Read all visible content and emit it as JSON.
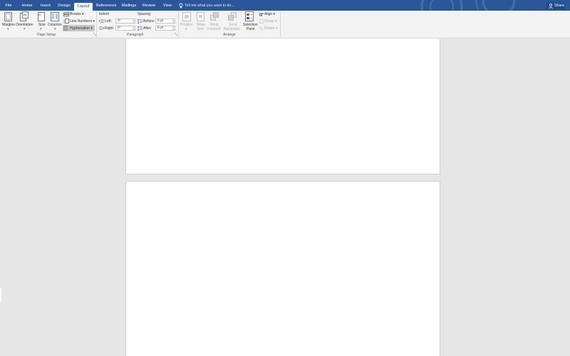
{
  "tabs": [
    {
      "label": "File",
      "active": false
    },
    {
      "label": "Home",
      "active": false
    },
    {
      "label": "Insert",
      "active": false
    },
    {
      "label": "Design",
      "active": false
    },
    {
      "label": "Layout",
      "active": true
    },
    {
      "label": "References",
      "active": false
    },
    {
      "label": "Mailings",
      "active": false
    },
    {
      "label": "Review",
      "active": false
    },
    {
      "label": "View",
      "active": false
    }
  ],
  "tell_me": {
    "placeholder": "Tell me what you want to do..."
  },
  "share": {
    "label": "Share"
  },
  "page_setup": {
    "margins": "Margins",
    "orientation": "Orientation",
    "size": "Size",
    "columns": "Columns",
    "breaks": "Breaks",
    "line_numbers": "Line Numbers",
    "hyphenation": "Hyphenation",
    "group_label": "Page Setup"
  },
  "paragraph": {
    "indent_heading": "Indent",
    "left_label": "Left:",
    "left_value": "0\"",
    "right_label": "Right:",
    "right_value": "0\"",
    "spacing_heading": "Spacing",
    "before_label": "Before:",
    "before_value": "0 pt",
    "after_label": "After:",
    "after_value": "0 pt",
    "group_label": "Paragraph"
  },
  "arrange": {
    "position": "Position",
    "wrap_text_1": "Wrap",
    "wrap_text_2": "Text",
    "bring_forward_1": "Bring",
    "bring_forward_2": "Forward",
    "send_backward_1": "Send",
    "send_backward_2": "Backward",
    "selection_pane_1": "Selection",
    "selection_pane_2": "Pane",
    "align": "Align",
    "group": "Group",
    "rotate": "Rotate",
    "group_label": "Arrange"
  },
  "colors": {
    "accent": "#2b579a",
    "ribbon_bg": "#f3f3f3",
    "canvas_bg": "#e6e6e6",
    "page_bg": "#ffffff"
  }
}
